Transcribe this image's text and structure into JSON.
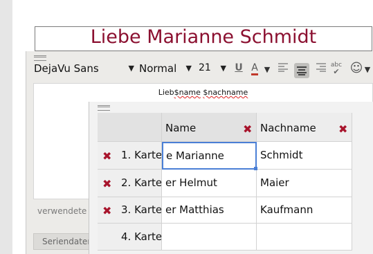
{
  "card_title": "Liebe Marianne Schmidt",
  "toolbar": {
    "font": "DejaVu Sans",
    "style": "Normal",
    "size": "21",
    "underline": "U",
    "font_color": "A",
    "spell": "abc",
    "emoji": "☺"
  },
  "editor": {
    "template_prefix": "Lieb",
    "field_name": "$name",
    "field_surname": "$nachname",
    "used_fields_label": "verwendete Fe",
    "data_button": "Seriendaten"
  },
  "table": {
    "columns": [
      "Name",
      "Nachname"
    ],
    "rows": [
      {
        "label": "1. Karte",
        "name": "e Marianne",
        "nachname": "Schmidt"
      },
      {
        "label": "2. Karte",
        "name": "er Helmut",
        "nachname": "Maier"
      },
      {
        "label": "3. Karte",
        "name": "er Matthias",
        "nachname": "Kaufmann"
      },
      {
        "label": "4. Karte",
        "name": "",
        "nachname": ""
      }
    ],
    "delete_icon": "✖"
  },
  "colors": {
    "accent": "#8b1030",
    "delete": "#a8142c",
    "focus": "#4a7fd6"
  }
}
